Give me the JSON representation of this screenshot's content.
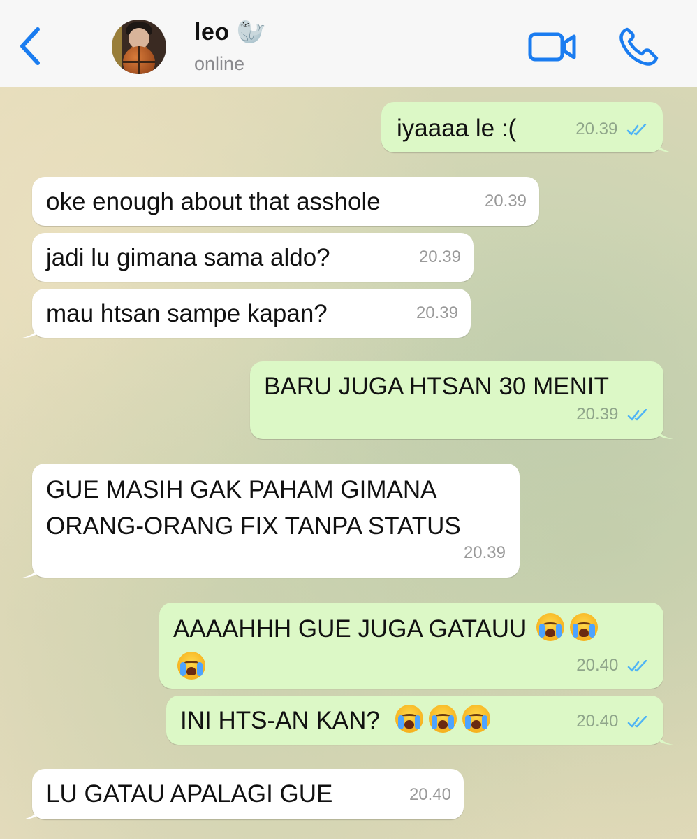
{
  "header": {
    "name": "leo 🦭",
    "status": "online"
  },
  "icons": {
    "back": "chevron-left-icon",
    "video": "video-camera-icon",
    "call": "phone-icon"
  },
  "colors": {
    "accent": "#1a7cf0",
    "incoming_bubble": "#ffffff",
    "outgoing_bubble": "#dcf8c6",
    "read_ticks": "#4fb4f5"
  },
  "messages": [
    {
      "dir": "out",
      "text": "iyaaaa le :(",
      "time": "20.39"
    },
    {
      "dir": "in",
      "text": "oke enough about that asshole",
      "time": "20.39"
    },
    {
      "dir": "in",
      "text": "jadi lu gimana sama aldo?",
      "time": "20.39"
    },
    {
      "dir": "in",
      "text": "mau htsan sampe kapan?",
      "time": "20.39"
    },
    {
      "dir": "out",
      "text": "BARU JUGA HTSAN 30 MENIT",
      "time": "20.39"
    },
    {
      "dir": "in",
      "line1": "GUE MASIH GAK PAHAM GIMANA",
      "line2": "ORANG-ORANG FIX TANPA STATUS",
      "time": "20.39"
    },
    {
      "dir": "out",
      "text": "AAAAHHH GUE JUGA GATAUU",
      "emoji": "😭",
      "time": "20.40"
    },
    {
      "dir": "out",
      "text": "INI HTS-AN KAN?",
      "emoji": "😭",
      "time": "20.40"
    },
    {
      "dir": "in",
      "text": "LU GATAU APALAGI GUE",
      "time": "20.40"
    }
  ]
}
